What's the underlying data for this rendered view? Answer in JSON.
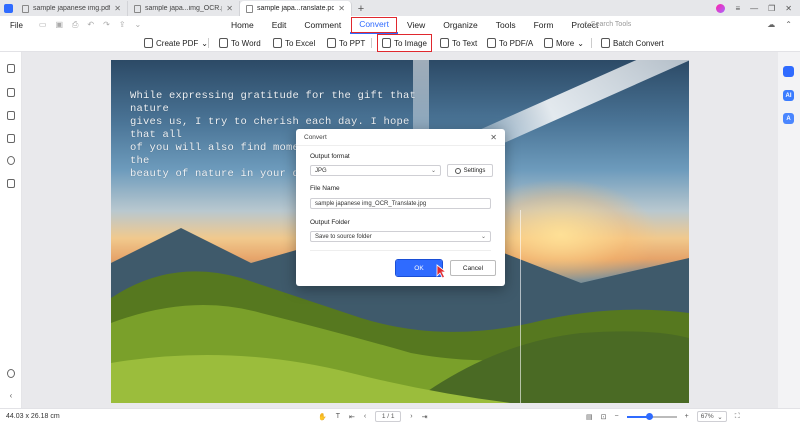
{
  "tabs": [
    {
      "label": "sample japanese img.pdf",
      "active": false
    },
    {
      "label": "sample japa...img_OCR.pdf",
      "active": false
    },
    {
      "label": "sample japa...ranslate.pdf",
      "active": true
    }
  ],
  "menu": {
    "file": "File",
    "items": [
      "Home",
      "Edit",
      "Comment",
      "Convert",
      "View",
      "Organize",
      "Tools",
      "Form",
      "Protect"
    ],
    "active": "Convert",
    "search_placeholder": "Search Tools"
  },
  "toolbar": {
    "create_pdf": "Create PDF",
    "to_word": "To Word",
    "to_excel": "To Excel",
    "to_ppt": "To PPT",
    "to_image": "To Image",
    "to_text": "To Text",
    "to_pdfa": "To PDF/A",
    "more": "More",
    "batch_convert": "Batch Convert"
  },
  "document": {
    "text_lines": [
      "While expressing gratitude for the gift that nature",
      "gives us, I try to cherish each day. I hope that all",
      "of you will also find moments of pleasure in the",
      "beauty of nature in your daily life."
    ]
  },
  "dialog": {
    "title": "Convert",
    "output_format_label": "Output format",
    "output_format_value": "JPG",
    "settings_label": "Settings",
    "file_name_label": "File Name",
    "file_name_value": "sample japanese img_OCR_Translate.jpg",
    "output_folder_label": "Output Folder",
    "output_folder_value": "Save to source folder",
    "ok_label": "OK",
    "cancel_label": "Cancel"
  },
  "status": {
    "dimensions": "44.03 x 26.18 cm",
    "page_display": "1 / 1",
    "zoom": "67%",
    "zoom_fraction": 0.45
  },
  "colors": {
    "accent": "#2f6bff",
    "highlight_box": "#e0282e"
  },
  "icons": [
    "app-logo-icon",
    "file-icon",
    "bookmark-icon",
    "comment-icon",
    "attachment-icon",
    "search-icon",
    "layers-icon",
    "help-icon",
    "gear-icon",
    "hand-icon",
    "select-text-icon",
    "cursor-icon"
  ]
}
